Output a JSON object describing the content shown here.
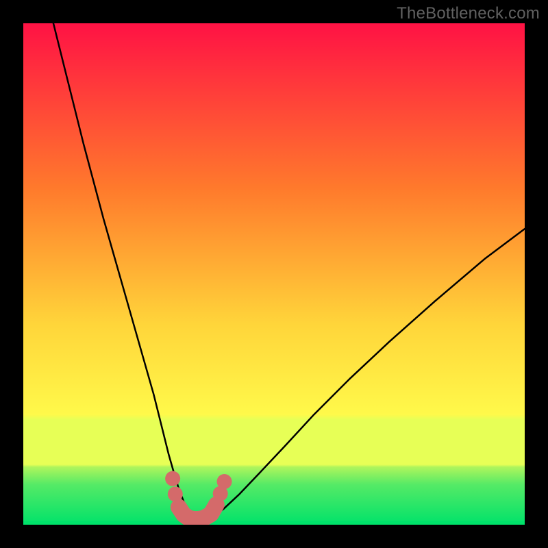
{
  "watermark": "TheBottleneck.com",
  "colors": {
    "frame": "#000000",
    "curve": "#000000",
    "markers": "#d46a6a",
    "band_bottom": "#00e26a",
    "band_mid": "#e7ff56",
    "gradient_top": "#ff1244",
    "gradient_orange": "#ff8a2a",
    "gradient_yellow": "#ffe73b"
  },
  "chart_data": {
    "type": "line",
    "title": "",
    "xlabel": "",
    "ylabel": "",
    "xlim": [
      0,
      100
    ],
    "ylim": [
      0,
      100
    ],
    "curve": {
      "name": "bottleneck-curve",
      "x": [
        6,
        8,
        10,
        12,
        14,
        16,
        18,
        20,
        22,
        24,
        26,
        27,
        28,
        29,
        30,
        31,
        32,
        33,
        34,
        35,
        36,
        38,
        40,
        43,
        47,
        52,
        58,
        65,
        73,
        82,
        92,
        100
      ],
      "y": [
        100,
        92,
        84,
        76,
        68.5,
        61,
        54,
        47,
        40,
        33,
        26,
        22,
        18,
        14,
        10.5,
        7.2,
        4.6,
        2.7,
        1.6,
        1.2,
        1.2,
        1.7,
        3.2,
        6.0,
        10.2,
        15.5,
        22,
        29,
        36.5,
        44.5,
        53,
        59
      ]
    },
    "markers": {
      "name": "highlight-points",
      "x": [
        29.8,
        30.3,
        31.0,
        32.0,
        33.0,
        34.0,
        35.0,
        36.0,
        37.4,
        38.5,
        39.3,
        40.1
      ],
      "y": [
        9.2,
        6.1,
        3.5,
        2.0,
        1.3,
        1.1,
        1.1,
        1.3,
        2.1,
        4.0,
        6.2,
        8.6
      ]
    },
    "gradient_stops": [
      {
        "offset": 0.0,
        "color": "#ff1244"
      },
      {
        "offset": 0.33,
        "color": "#ff7a2c"
      },
      {
        "offset": 0.6,
        "color": "#ffd53a"
      },
      {
        "offset": 0.78,
        "color": "#fff94a"
      },
      {
        "offset": 0.79,
        "color": "#e7ff56"
      },
      {
        "offset": 0.88,
        "color": "#e7ff56"
      },
      {
        "offset": 0.885,
        "color": "#aef55c"
      },
      {
        "offset": 0.92,
        "color": "#55ea66"
      },
      {
        "offset": 1.0,
        "color": "#00e26a"
      }
    ]
  }
}
